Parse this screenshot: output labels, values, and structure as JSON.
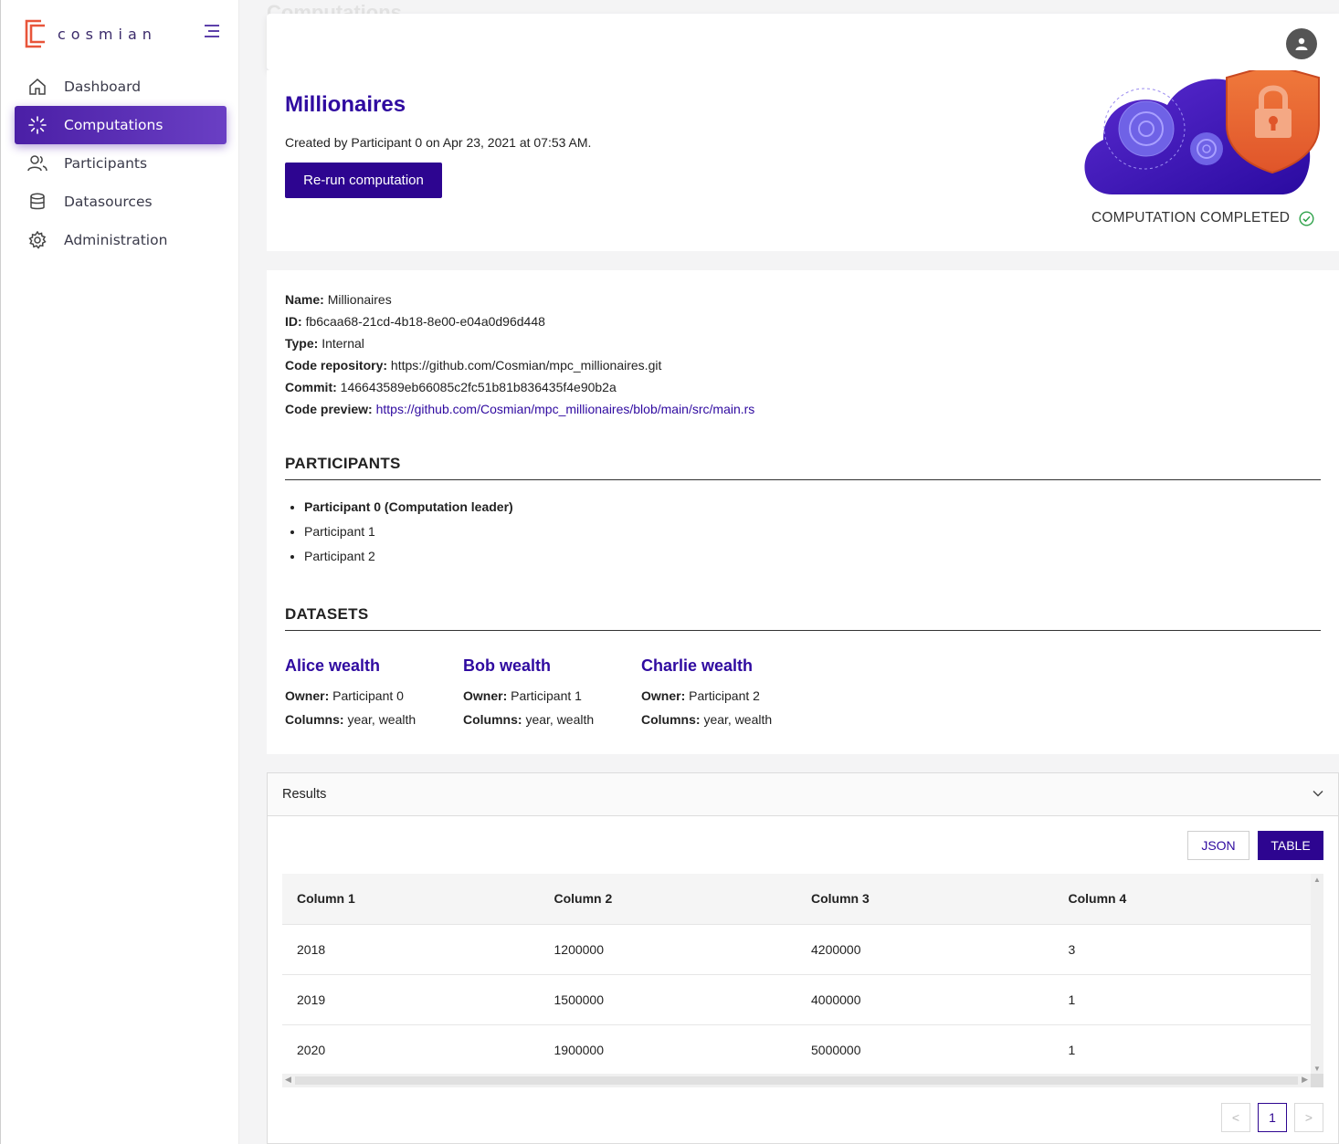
{
  "app": {
    "brand": "cosmian",
    "brand_color": "#2d0590",
    "accent_color": "#5a2fb0",
    "logo_color": "#e8553a"
  },
  "page_title": "Computations",
  "sidebar": {
    "items": [
      {
        "label": "Dashboard",
        "icon": "home-icon"
      },
      {
        "label": "Computations",
        "icon": "spinner-icon",
        "active": true
      },
      {
        "label": "Participants",
        "icon": "users-icon"
      },
      {
        "label": "Datasources",
        "icon": "database-icon"
      },
      {
        "label": "Administration",
        "icon": "gear-icon"
      }
    ]
  },
  "computation": {
    "title": "Millionaires",
    "created": "Created by Participant 0 on Apr 23, 2021 at 07:53 AM.",
    "rerun_label": "Re-run computation",
    "status": "COMPUTATION COMPLETED"
  },
  "info": {
    "name_label": "Name:",
    "name": "Millionaires",
    "id_label": "ID:",
    "id": "fb6caa68-21cd-4b18-8e00-e04a0d96d448",
    "type_label": "Type:",
    "type": "Internal",
    "repo_label": "Code repository:",
    "repo": "https://github.com/Cosmian/mpc_millionaires.git",
    "commit_label": "Commit:",
    "commit": "146643589eb66085c2fc51b81b836435f4e90b2a",
    "preview_label": "Code preview:",
    "preview": "https://github.com/Cosmian/mpc_millionaires/blob/main/src/main.rs"
  },
  "participants": {
    "heading": "PARTICIPANTS",
    "items": [
      "Participant 0 (Computation leader)",
      "Participant 1",
      "Participant 2"
    ]
  },
  "datasets": {
    "heading": "DATASETS",
    "owner_label": "Owner:",
    "columns_label": "Columns:",
    "items": [
      {
        "name": "Alice wealth",
        "owner": "Participant 0",
        "columns": "year, wealth"
      },
      {
        "name": "Bob wealth",
        "owner": "Participant 1",
        "columns": "year, wealth"
      },
      {
        "name": "Charlie wealth",
        "owner": "Participant 2",
        "columns": "year, wealth"
      }
    ]
  },
  "results": {
    "title": "Results",
    "json_label": "JSON",
    "table_label": "TABLE",
    "columns": [
      "Column 1",
      "Column 2",
      "Column 3",
      "Column 4"
    ],
    "rows": [
      [
        "2018",
        "1200000",
        "4200000",
        "3"
      ],
      [
        "2019",
        "1500000",
        "4000000",
        "1"
      ],
      [
        "2020",
        "1900000",
        "5000000",
        "1"
      ]
    ],
    "pager": {
      "prev": "<",
      "page": "1",
      "next": ">"
    }
  }
}
